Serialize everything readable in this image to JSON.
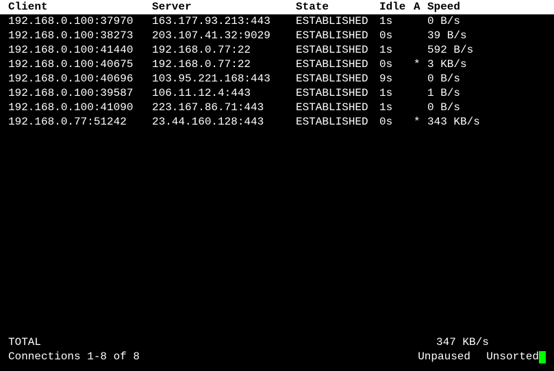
{
  "header": {
    "client": "Client",
    "server": "Server",
    "state": "State",
    "idle": "Idle",
    "a": "A",
    "speed": "Speed"
  },
  "rows": [
    {
      "client": "192.168.0.100:37970",
      "server": "163.177.93.213:443",
      "state": "ESTABLISHED",
      "idle": "1s",
      "a": " ",
      "speed": "0 B/s"
    },
    {
      "client": "192.168.0.100:38273",
      "server": "203.107.41.32:9029",
      "state": "ESTABLISHED",
      "idle": "0s",
      "a": " ",
      "speed": "39 B/s"
    },
    {
      "client": "192.168.0.100:41440",
      "server": "192.168.0.77:22",
      "state": "ESTABLISHED",
      "idle": "1s",
      "a": " ",
      "speed": "592 B/s"
    },
    {
      "client": "192.168.0.100:40675",
      "server": "192.168.0.77:22",
      "state": "ESTABLISHED",
      "idle": "0s",
      "a": "*",
      "speed": "3 KB/s"
    },
    {
      "client": "192.168.0.100:40696",
      "server": "103.95.221.168:443",
      "state": "ESTABLISHED",
      "idle": "9s",
      "a": " ",
      "speed": "0 B/s"
    },
    {
      "client": "192.168.0.100:39587",
      "server": "106.11.12.4:443",
      "state": "ESTABLISHED",
      "idle": "1s",
      "a": " ",
      "speed": "1 B/s"
    },
    {
      "client": "192.168.0.100:41090",
      "server": "223.167.86.71:443",
      "state": "ESTABLISHED",
      "idle": "1s",
      "a": " ",
      "speed": "0 B/s"
    },
    {
      "client": "192.168.0.77:51242",
      "server": "23.44.160.128:443",
      "state": "ESTABLISHED",
      "idle": "0s",
      "a": "*",
      "speed": "343 KB/s"
    }
  ],
  "footer": {
    "total_label": "TOTAL",
    "total_speed": "347 KB/s",
    "connections": "Connections 1-8 of 8",
    "pause_state": "Unpaused",
    "sort_state": "Unsorted"
  }
}
